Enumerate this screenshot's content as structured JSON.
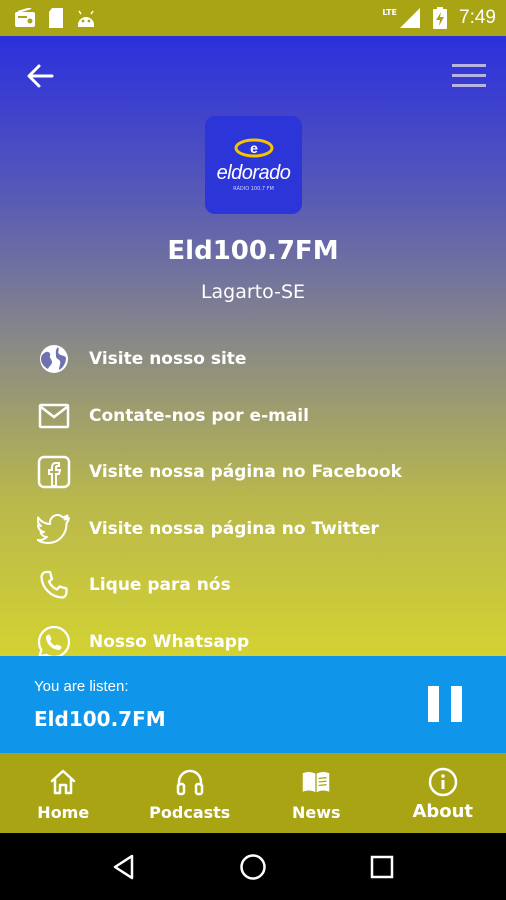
{
  "status_bar": {
    "time": "7:49",
    "network": "LTE",
    "icons": [
      "radio-icon",
      "sd-card-icon",
      "android-icon",
      "signal-icon",
      "battery-charging-icon"
    ]
  },
  "header": {
    "back_icon": "arrow-left-icon",
    "menu_icon": "hamburger-menu-icon"
  },
  "station": {
    "logo_text": "eldorado",
    "logo_subtext": "RÁDIO 100,7 FM",
    "name": "Eld100.7FM",
    "city": "Lagarto-SE"
  },
  "links": [
    {
      "icon": "globe-icon",
      "label": "Visite nosso site"
    },
    {
      "icon": "mail-icon",
      "label": "Contate-nos por e-mail"
    },
    {
      "icon": "facebook-icon",
      "label": "Visite nossa página no Facebook"
    },
    {
      "icon": "twitter-icon",
      "label": "Visite nossa página no Twitter"
    },
    {
      "icon": "phone-icon",
      "label": "Lique para nós"
    },
    {
      "icon": "whatsapp-icon",
      "label": "Nosso Whatsapp"
    }
  ],
  "player": {
    "caption": "You are listen:",
    "title": "Eld100.7FM",
    "control_icon": "pause-icon"
  },
  "tabs": [
    {
      "icon": "home-icon",
      "label": "Home"
    },
    {
      "icon": "headphones-icon",
      "label": "Podcasts"
    },
    {
      "icon": "book-open-icon",
      "label": "News"
    },
    {
      "icon": "info-icon",
      "label": "About"
    }
  ],
  "colors": {
    "status_bar": "#a9a414",
    "gradient_top": "#2b2fdd",
    "gradient_bottom": "#d3d232",
    "player": "#0f96ea",
    "tab_bar": "#a9a414"
  }
}
